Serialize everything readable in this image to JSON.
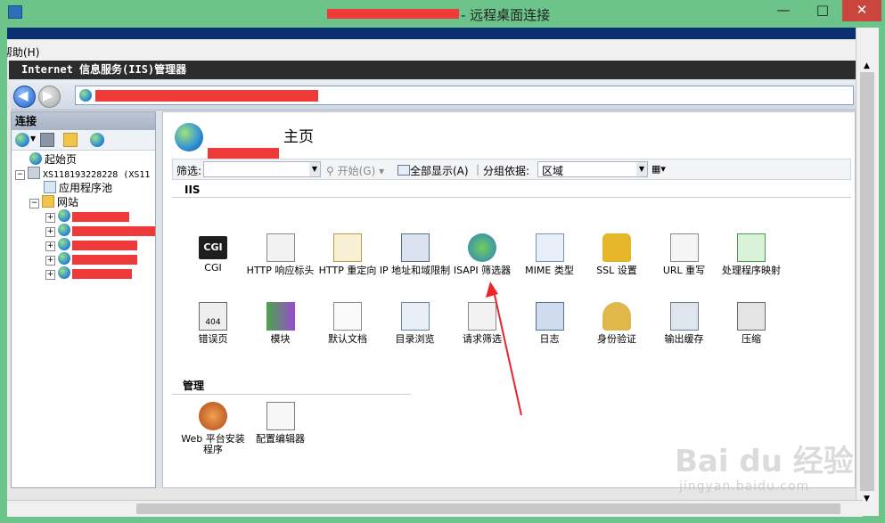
{
  "rdp": {
    "title": "- 远程桌面连接",
    "min_btn": "—",
    "max_btn": "□",
    "close_btn": "✕"
  },
  "menubar": {
    "help_label": "帮助(H)"
  },
  "iis": {
    "window_title": "Internet 信息服务(IIS)管理器"
  },
  "connections": {
    "header": "连接",
    "tree": {
      "start_page": "起始页",
      "server": "XS118193228228 (XS11",
      "app_pools": "应用程序池",
      "sites": "网站"
    }
  },
  "main": {
    "title": "主页",
    "filter_label": "筛选:",
    "start_btn": "开始(G)",
    "show_all_btn": "全部显示(A)",
    "group_label": "分组依据:",
    "group_value": "区域",
    "section_iis": "IIS",
    "section_manage": "管理",
    "iis_features": [
      {
        "label": "CGI",
        "icon": "cgi-icon"
      },
      {
        "label": "HTTP 响应标头",
        "icon": "http-response-headers-icon"
      },
      {
        "label": "HTTP 重定向",
        "icon": "http-redirect-icon"
      },
      {
        "label": "IP 地址和域限制",
        "icon": "ip-domain-restrictions-icon"
      },
      {
        "label": "ISAPI 筛选器",
        "icon": "isapi-filters-icon"
      },
      {
        "label": "MIME 类型",
        "icon": "mime-types-icon"
      },
      {
        "label": "SSL 设置",
        "icon": "ssl-settings-icon"
      },
      {
        "label": "URL 重写",
        "icon": "url-rewrite-icon"
      },
      {
        "label": "处理程序映射",
        "icon": "handler-mappings-icon"
      },
      {
        "label": "错误页",
        "icon": "error-pages-icon"
      },
      {
        "label": "模块",
        "icon": "modules-icon"
      },
      {
        "label": "默认文档",
        "icon": "default-document-icon"
      },
      {
        "label": "目录浏览",
        "icon": "directory-browsing-icon"
      },
      {
        "label": "请求筛选",
        "icon": "request-filtering-icon"
      },
      {
        "label": "日志",
        "icon": "logging-icon"
      },
      {
        "label": "身份验证",
        "icon": "authentication-icon"
      },
      {
        "label": "输出缓存",
        "icon": "output-caching-icon"
      },
      {
        "label": "压缩",
        "icon": "compression-icon"
      }
    ],
    "manage_features": [
      {
        "label": "Web 平台安装程序",
        "icon": "web-platform-installer-icon"
      },
      {
        "label": "配置编辑器",
        "icon": "configuration-editor-icon"
      }
    ]
  },
  "watermark": {
    "main": "Bai du 经验",
    "sub": "jingyan.baidu.com"
  },
  "colors": {
    "rdp_frame": "#6cc48a",
    "redaction": "#f03a3a",
    "annotation_arrow": "#e8262c"
  }
}
